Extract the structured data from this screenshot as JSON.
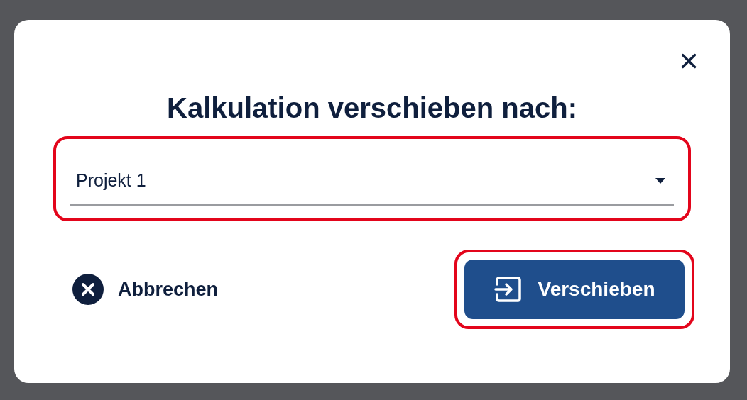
{
  "dialog": {
    "title": "Kalkulation verschieben nach:",
    "select": {
      "value": "Projekt 1",
      "highlighted": true
    },
    "cancel": {
      "label": "Abbrechen"
    },
    "confirm": {
      "label": "Verschieben",
      "highlighted": true
    }
  }
}
